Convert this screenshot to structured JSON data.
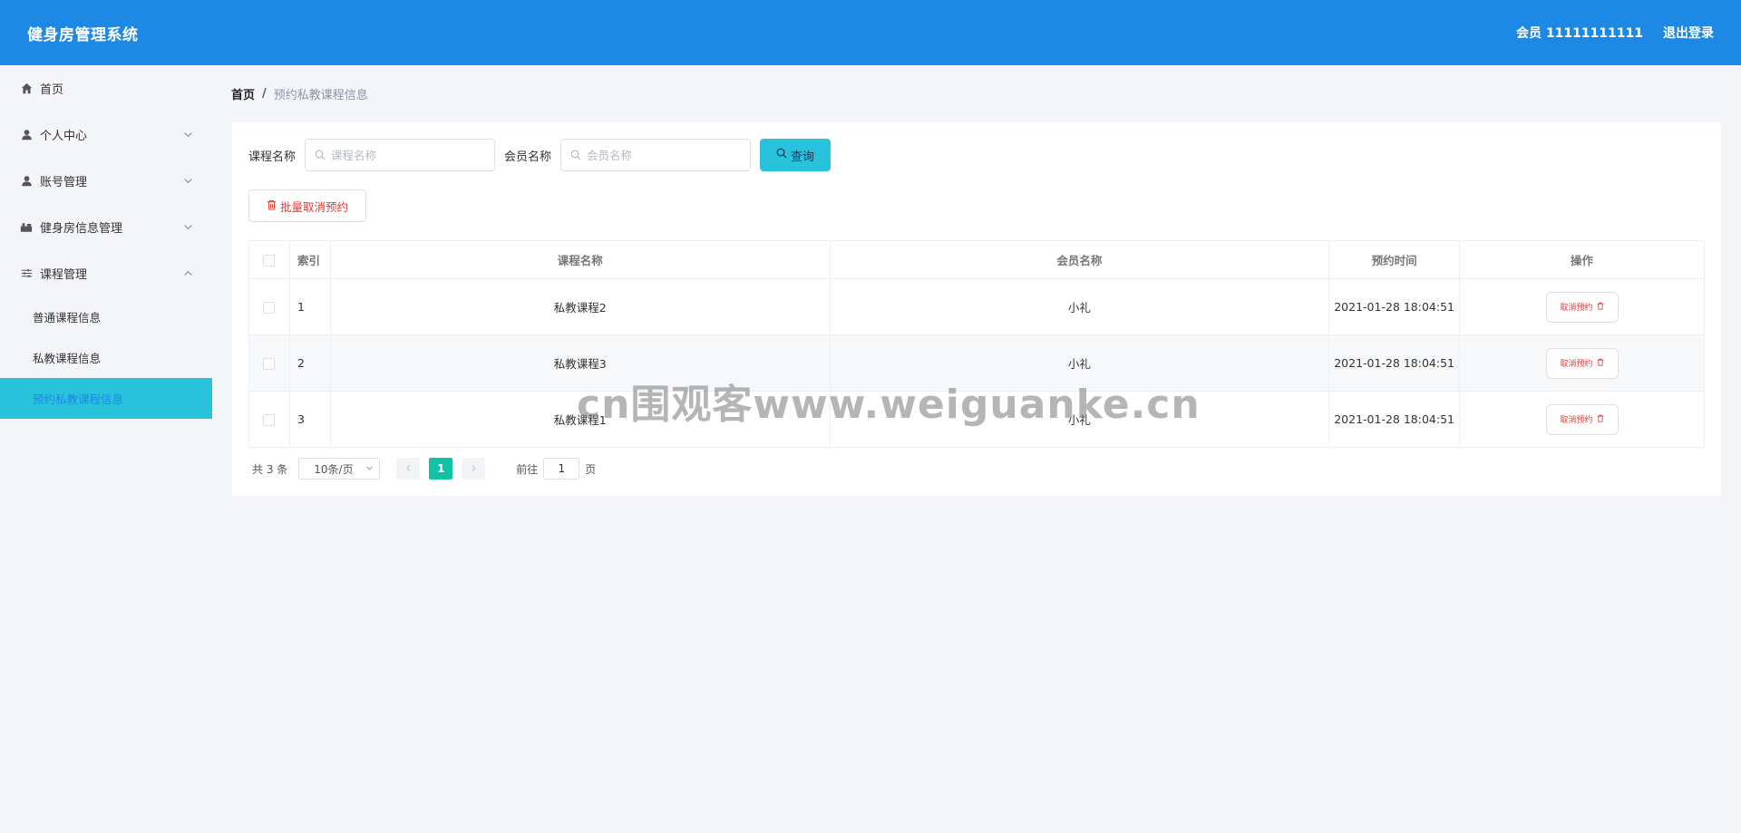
{
  "header": {
    "title": "健身房管理系统",
    "user_label": "会员 11111111111",
    "logout_label": "退出登录"
  },
  "sidebar": {
    "items": [
      {
        "label": "首页",
        "icon": "home-icon"
      },
      {
        "label": "个人中心",
        "icon": "user-icon",
        "expandable": true
      },
      {
        "label": "账号管理",
        "icon": "user-icon",
        "expandable": true
      },
      {
        "label": "健身房信息管理",
        "icon": "building-icon",
        "expandable": true
      },
      {
        "label": "课程管理",
        "icon": "sliders-icon",
        "expanded": true
      }
    ],
    "subitems": [
      {
        "label": "普通课程信息"
      },
      {
        "label": "私教课程信息"
      },
      {
        "label": "预约私教课程信息",
        "active": true
      }
    ]
  },
  "breadcrumb": {
    "home": "首页",
    "separator": "/",
    "current": "预约私教课程信息"
  },
  "filters": {
    "course_label": "课程名称",
    "course_placeholder": "课程名称",
    "member_label": "会员名称",
    "member_placeholder": "会员名称",
    "query_label": "查询"
  },
  "batch_cancel_label": "批量取消预约",
  "table": {
    "headers": {
      "index": "索引",
      "course": "课程名称",
      "member": "会员名称",
      "time": "预约时间",
      "action": "操作"
    },
    "rows": [
      {
        "index": "1",
        "course": "私教课程2",
        "member": "小礼",
        "time": "2021-01-28 18:04:51",
        "action": "取消预约"
      },
      {
        "index": "2",
        "course": "私教课程3",
        "member": "小礼",
        "time": "2021-01-28 18:04:51",
        "action": "取消预约"
      },
      {
        "index": "3",
        "course": "私教课程1",
        "member": "小礼",
        "time": "2021-01-28 18:04:51",
        "action": "取消预约"
      }
    ]
  },
  "pagination": {
    "total": "共 3 条",
    "page_size": "10条/页",
    "current_page": "1",
    "goto_label": "前往",
    "goto_value": "1",
    "page_suffix": "页"
  },
  "watermark": "cn围观客www.weiguanke.cn",
  "colors": {
    "header_bg": "#1e88e5",
    "active_menu_bg": "#28c2dc",
    "query_button": "#28c2dc",
    "danger": "#e53935",
    "page_active": "#13c2a2"
  }
}
